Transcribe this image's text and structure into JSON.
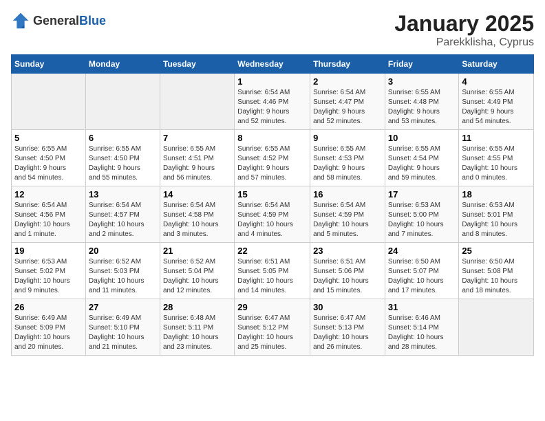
{
  "header": {
    "logo_general": "General",
    "logo_blue": "Blue",
    "title": "January 2025",
    "subtitle": "Parekklisha, Cyprus"
  },
  "days_of_week": [
    "Sunday",
    "Monday",
    "Tuesday",
    "Wednesday",
    "Thursday",
    "Friday",
    "Saturday"
  ],
  "weeks": [
    [
      {
        "day": "",
        "info": ""
      },
      {
        "day": "",
        "info": ""
      },
      {
        "day": "",
        "info": ""
      },
      {
        "day": "1",
        "info": "Sunrise: 6:54 AM\nSunset: 4:46 PM\nDaylight: 9 hours\nand 52 minutes."
      },
      {
        "day": "2",
        "info": "Sunrise: 6:54 AM\nSunset: 4:47 PM\nDaylight: 9 hours\nand 52 minutes."
      },
      {
        "day": "3",
        "info": "Sunrise: 6:55 AM\nSunset: 4:48 PM\nDaylight: 9 hours\nand 53 minutes."
      },
      {
        "day": "4",
        "info": "Sunrise: 6:55 AM\nSunset: 4:49 PM\nDaylight: 9 hours\nand 54 minutes."
      }
    ],
    [
      {
        "day": "5",
        "info": "Sunrise: 6:55 AM\nSunset: 4:50 PM\nDaylight: 9 hours\nand 54 minutes."
      },
      {
        "day": "6",
        "info": "Sunrise: 6:55 AM\nSunset: 4:50 PM\nDaylight: 9 hours\nand 55 minutes."
      },
      {
        "day": "7",
        "info": "Sunrise: 6:55 AM\nSunset: 4:51 PM\nDaylight: 9 hours\nand 56 minutes."
      },
      {
        "day": "8",
        "info": "Sunrise: 6:55 AM\nSunset: 4:52 PM\nDaylight: 9 hours\nand 57 minutes."
      },
      {
        "day": "9",
        "info": "Sunrise: 6:55 AM\nSunset: 4:53 PM\nDaylight: 9 hours\nand 58 minutes."
      },
      {
        "day": "10",
        "info": "Sunrise: 6:55 AM\nSunset: 4:54 PM\nDaylight: 9 hours\nand 59 minutes."
      },
      {
        "day": "11",
        "info": "Sunrise: 6:55 AM\nSunset: 4:55 PM\nDaylight: 10 hours\nand 0 minutes."
      }
    ],
    [
      {
        "day": "12",
        "info": "Sunrise: 6:54 AM\nSunset: 4:56 PM\nDaylight: 10 hours\nand 1 minute."
      },
      {
        "day": "13",
        "info": "Sunrise: 6:54 AM\nSunset: 4:57 PM\nDaylight: 10 hours\nand 2 minutes."
      },
      {
        "day": "14",
        "info": "Sunrise: 6:54 AM\nSunset: 4:58 PM\nDaylight: 10 hours\nand 3 minutes."
      },
      {
        "day": "15",
        "info": "Sunrise: 6:54 AM\nSunset: 4:59 PM\nDaylight: 10 hours\nand 4 minutes."
      },
      {
        "day": "16",
        "info": "Sunrise: 6:54 AM\nSunset: 4:59 PM\nDaylight: 10 hours\nand 5 minutes."
      },
      {
        "day": "17",
        "info": "Sunrise: 6:53 AM\nSunset: 5:00 PM\nDaylight: 10 hours\nand 7 minutes."
      },
      {
        "day": "18",
        "info": "Sunrise: 6:53 AM\nSunset: 5:01 PM\nDaylight: 10 hours\nand 8 minutes."
      }
    ],
    [
      {
        "day": "19",
        "info": "Sunrise: 6:53 AM\nSunset: 5:02 PM\nDaylight: 10 hours\nand 9 minutes."
      },
      {
        "day": "20",
        "info": "Sunrise: 6:52 AM\nSunset: 5:03 PM\nDaylight: 10 hours\nand 11 minutes."
      },
      {
        "day": "21",
        "info": "Sunrise: 6:52 AM\nSunset: 5:04 PM\nDaylight: 10 hours\nand 12 minutes."
      },
      {
        "day": "22",
        "info": "Sunrise: 6:51 AM\nSunset: 5:05 PM\nDaylight: 10 hours\nand 14 minutes."
      },
      {
        "day": "23",
        "info": "Sunrise: 6:51 AM\nSunset: 5:06 PM\nDaylight: 10 hours\nand 15 minutes."
      },
      {
        "day": "24",
        "info": "Sunrise: 6:50 AM\nSunset: 5:07 PM\nDaylight: 10 hours\nand 17 minutes."
      },
      {
        "day": "25",
        "info": "Sunrise: 6:50 AM\nSunset: 5:08 PM\nDaylight: 10 hours\nand 18 minutes."
      }
    ],
    [
      {
        "day": "26",
        "info": "Sunrise: 6:49 AM\nSunset: 5:09 PM\nDaylight: 10 hours\nand 20 minutes."
      },
      {
        "day": "27",
        "info": "Sunrise: 6:49 AM\nSunset: 5:10 PM\nDaylight: 10 hours\nand 21 minutes."
      },
      {
        "day": "28",
        "info": "Sunrise: 6:48 AM\nSunset: 5:11 PM\nDaylight: 10 hours\nand 23 minutes."
      },
      {
        "day": "29",
        "info": "Sunrise: 6:47 AM\nSunset: 5:12 PM\nDaylight: 10 hours\nand 25 minutes."
      },
      {
        "day": "30",
        "info": "Sunrise: 6:47 AM\nSunset: 5:13 PM\nDaylight: 10 hours\nand 26 minutes."
      },
      {
        "day": "31",
        "info": "Sunrise: 6:46 AM\nSunset: 5:14 PM\nDaylight: 10 hours\nand 28 minutes."
      },
      {
        "day": "",
        "info": ""
      }
    ]
  ]
}
